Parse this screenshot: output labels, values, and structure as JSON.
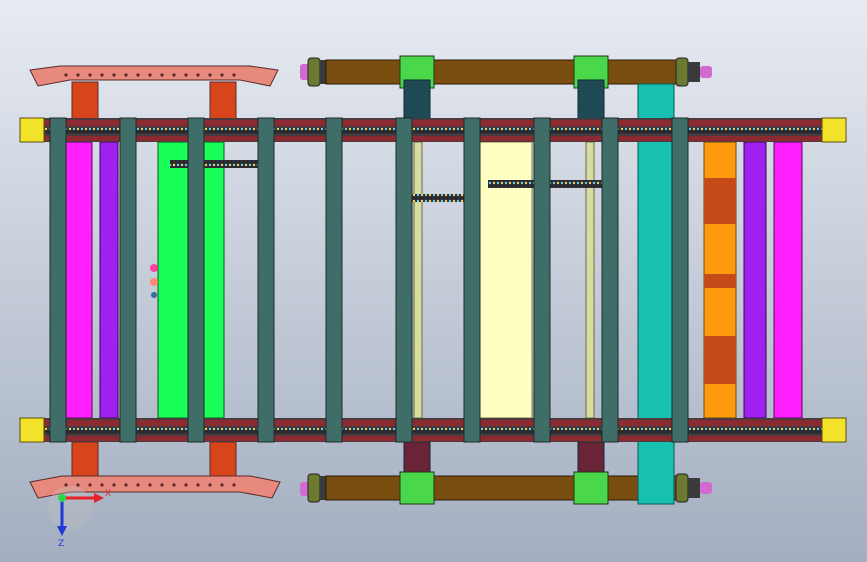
{
  "viewport": {
    "background_top": "#e7ebf2",
    "background_bottom": "#a3aec0"
  },
  "colors": {
    "rail_dark": "#4b3a3e",
    "rail_red": "#8b2a30",
    "crossbar": "#3f6e68",
    "crossbar_edge": "#1e2a2a",
    "magenta": "#ff1fff",
    "purple": "#a020f0",
    "green": "#19ff5a",
    "cream": "#ffffc2",
    "teal": "#17c0b0",
    "orange": "#ff9a10",
    "rust": "#c44a18",
    "brown": "#7a4e10",
    "salmon": "#e8897e",
    "olive_roller": "#6b7a30",
    "yellow_end": "#f2e22a"
  },
  "triad": {
    "x_label": "X",
    "z_label": "Z",
    "x_color": "#e8202a",
    "z_color": "#2038d8",
    "origin_color": "#2ad84a"
  },
  "icons": {
    "triad": "coordinate-triad-icon"
  }
}
